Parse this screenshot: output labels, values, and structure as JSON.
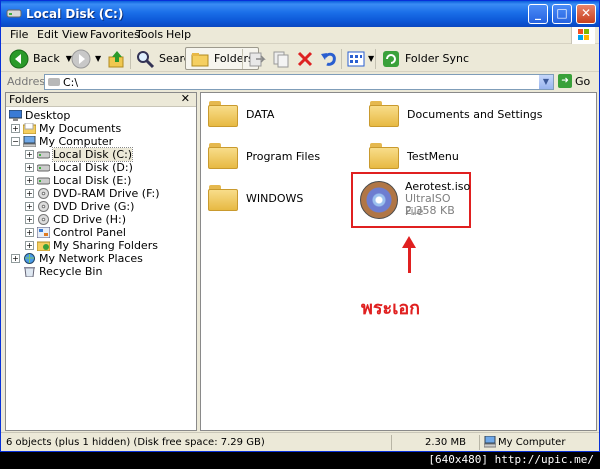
{
  "window": {
    "title": "Local Disk (C:)"
  },
  "menu": [
    "File",
    "Edit",
    "View",
    "Favorites",
    "Tools",
    "Help"
  ],
  "toolbar": {
    "back": "Back",
    "search": "Search",
    "folders": "Folders",
    "folder_sync": "Folder Sync"
  },
  "address": {
    "label": "Address",
    "value": "C:\\",
    "go": "Go"
  },
  "folders_pane": {
    "title": "Folders",
    "tree": [
      {
        "label": "Desktop",
        "icon": "desktop-icon"
      },
      {
        "label": "My Documents",
        "icon": "folder-icon"
      },
      {
        "label": "My Computer",
        "icon": "computer-icon"
      },
      {
        "label": "Local Disk (C:)",
        "icon": "drive-icon"
      },
      {
        "label": "Local Disk (D:)",
        "icon": "drive-icon"
      },
      {
        "label": "Local Disk (E:)",
        "icon": "drive-icon"
      },
      {
        "label": "DVD-RAM Drive (F:)",
        "icon": "cd-icon"
      },
      {
        "label": "DVD Drive (G:)",
        "icon": "cd-icon"
      },
      {
        "label": "CD Drive (H:)",
        "icon": "cd-icon"
      },
      {
        "label": "Control Panel",
        "icon": "control-panel-icon"
      },
      {
        "label": "My Sharing Folders",
        "icon": "shared-folder-icon"
      },
      {
        "label": "My Network Places",
        "icon": "network-icon"
      },
      {
        "label": "Recycle Bin",
        "icon": "recycle-bin-icon"
      }
    ]
  },
  "files": [
    {
      "name": "DATA"
    },
    {
      "name": "Documents and Settings"
    },
    {
      "name": "Program Files"
    },
    {
      "name": "TestMenu"
    },
    {
      "name": "WINDOWS"
    }
  ],
  "iso_file": {
    "name": "Aerotest.iso",
    "type": "UltraISO File",
    "size": "2,358 KB"
  },
  "annotation": "พระเอก",
  "status": {
    "objects": "6 objects (plus 1 hidden) (Disk free space: 7.29 GB)",
    "size": "2.30 MB",
    "location": "My Computer"
  },
  "watermark": "[640x480] http://upic.me/"
}
